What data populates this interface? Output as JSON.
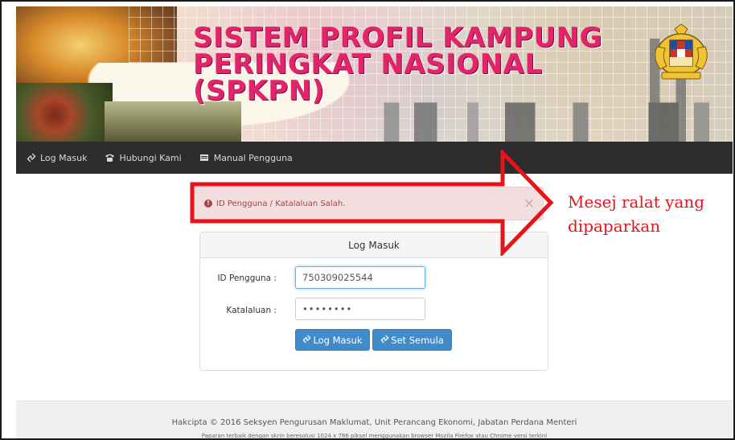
{
  "banner": {
    "title_line1": "SISTEM PROFIL KAMPUNG",
    "title_line2": "PERINGKAT NASIONAL",
    "title_line3": "(SPKPN)"
  },
  "navbar": {
    "items": [
      {
        "label": "Log Masuk",
        "icon": "link-icon"
      },
      {
        "label": "Hubungi Kami",
        "icon": "phone-icon"
      },
      {
        "label": "Manual Pengguna",
        "icon": "book-icon"
      }
    ]
  },
  "alert": {
    "message": "ID Pengguna / Katalaluan Salah.",
    "close_symbol": "×"
  },
  "login": {
    "heading": "Log Masuk",
    "user_label": "ID Pengguna :",
    "user_value": "750309025544",
    "password_label": "Katalaluan :",
    "password_value": "••••••••",
    "login_button": "Log Masuk",
    "reset_button": "Set Semula"
  },
  "footer": {
    "copyright": "Hakcipta © 2016 Seksyen Pengurusan Maklumat, Unit Perancang Ekonomi, Jabatan Perdana Menteri",
    "note": "Paparan terbaik dengan skrin beresolusi 1024 x 786 piksel menggunakan browser Mozila Firefox atau Chrome versi terkini"
  },
  "annotation": {
    "line1": "Mesej ralat yang",
    "line2": "dipaparkan"
  },
  "colors": {
    "title": "#e2246b",
    "navbar": "#2d2d2d",
    "alert_bg": "#f2dede",
    "alert_text": "#a94442",
    "button": "#428bca",
    "annotation": "#e8131a"
  }
}
